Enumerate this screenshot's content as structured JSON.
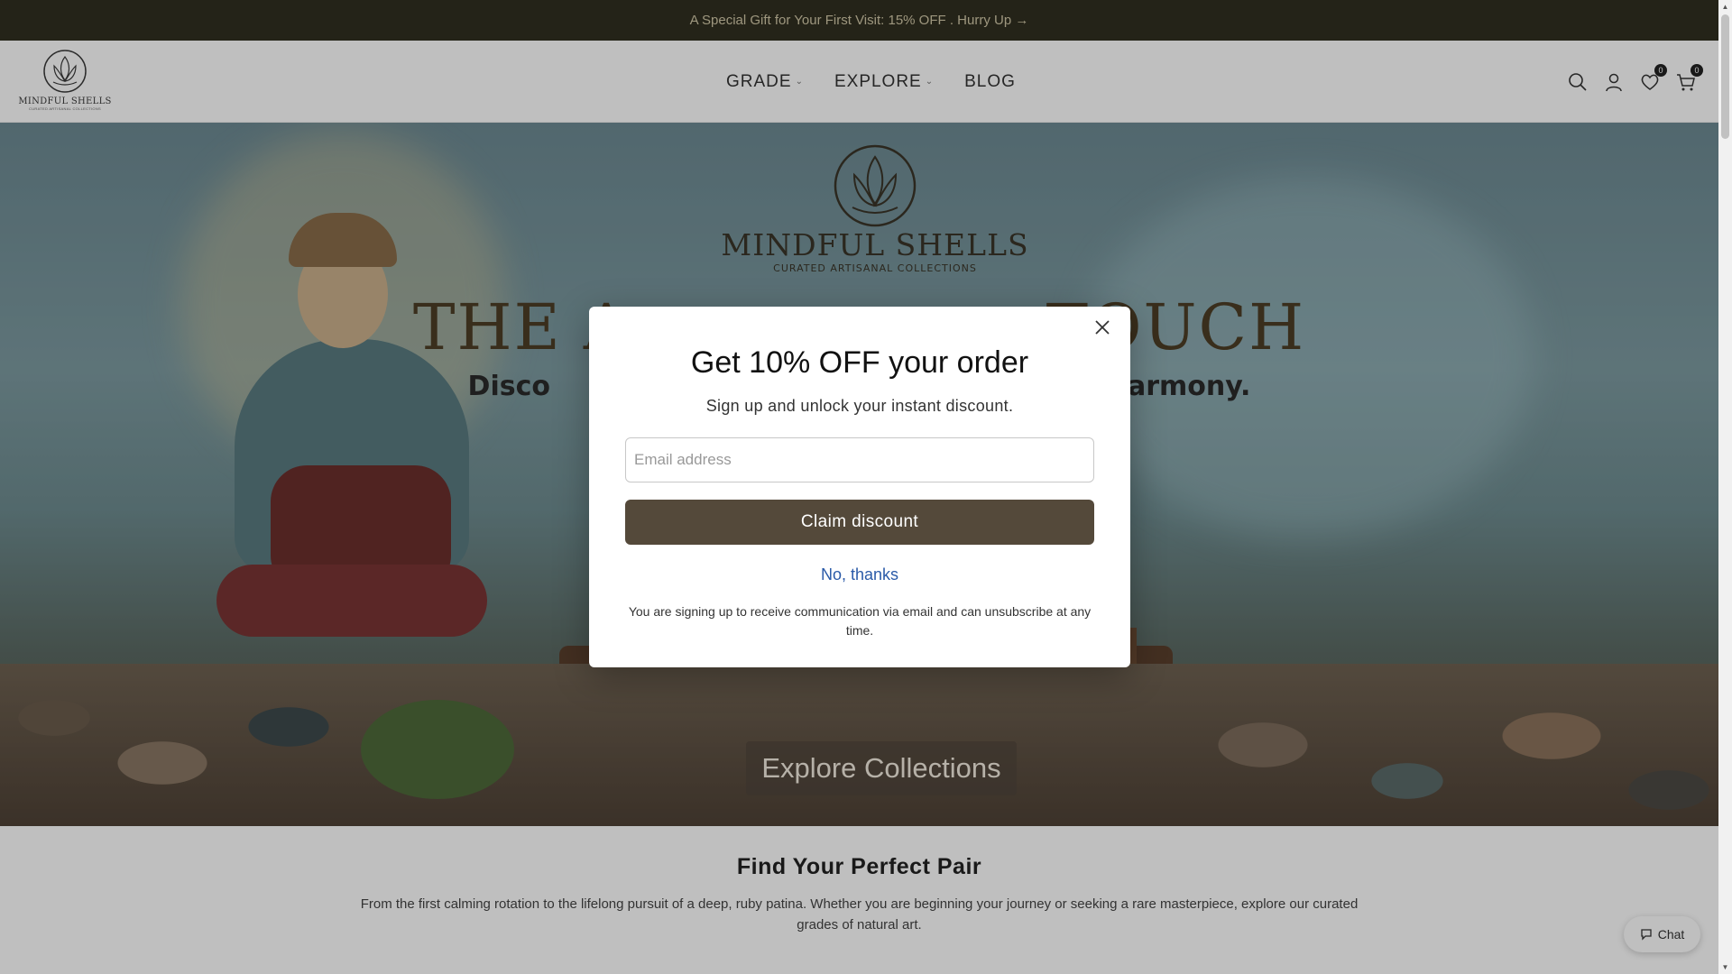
{
  "announcement": {
    "text": "A Special Gift for Your First Visit: 15% OFF . Hurry Up →"
  },
  "header": {
    "logo": {
      "name": "MINDFUL SHELLS",
      "tagline": "CURATED ARTISANAL COLLECTIONS"
    },
    "nav": [
      {
        "label": "GRADE",
        "has_dropdown": true
      },
      {
        "label": "EXPLORE",
        "has_dropdown": true
      },
      {
        "label": "BLOG",
        "has_dropdown": false
      }
    ],
    "icons": {
      "search": "search-icon",
      "account": "user-icon",
      "wishlist": "heart-icon",
      "cart": "cart-icon"
    },
    "wishlist_count": "0",
    "cart_count": "0"
  },
  "hero": {
    "logo_name": "MINDFUL SHELLS",
    "logo_tagline": "CURATED ARTISANAL COLLECTIONS",
    "title_left": "THE A",
    "title_right": "TOUCH",
    "subtitle_left": "Disco",
    "subtitle_right": "armony.",
    "cta": "Explore Collections"
  },
  "popup": {
    "title": "Get 10% OFF your order",
    "subtitle": "Sign up and unlock your instant discount.",
    "email_placeholder": "Email address",
    "email_value": "",
    "submit_label": "Claim discount",
    "decline_label": "No, thanks",
    "legal": "You are signing up to receive communication via email and can unsubscribe at any time."
  },
  "section": {
    "title": "Find Your Perfect Pair",
    "description": "From the first calming rotation to the lifelong pursuit of a deep, ruby patina. Whether you are beginning your journey or seeking a rare masterpiece, explore our curated grades of natural art."
  },
  "chat": {
    "label": "Chat"
  },
  "colors": {
    "announcement_bg": "#312f21",
    "button_bg": "#54493a",
    "link": "#2a5aa8"
  }
}
